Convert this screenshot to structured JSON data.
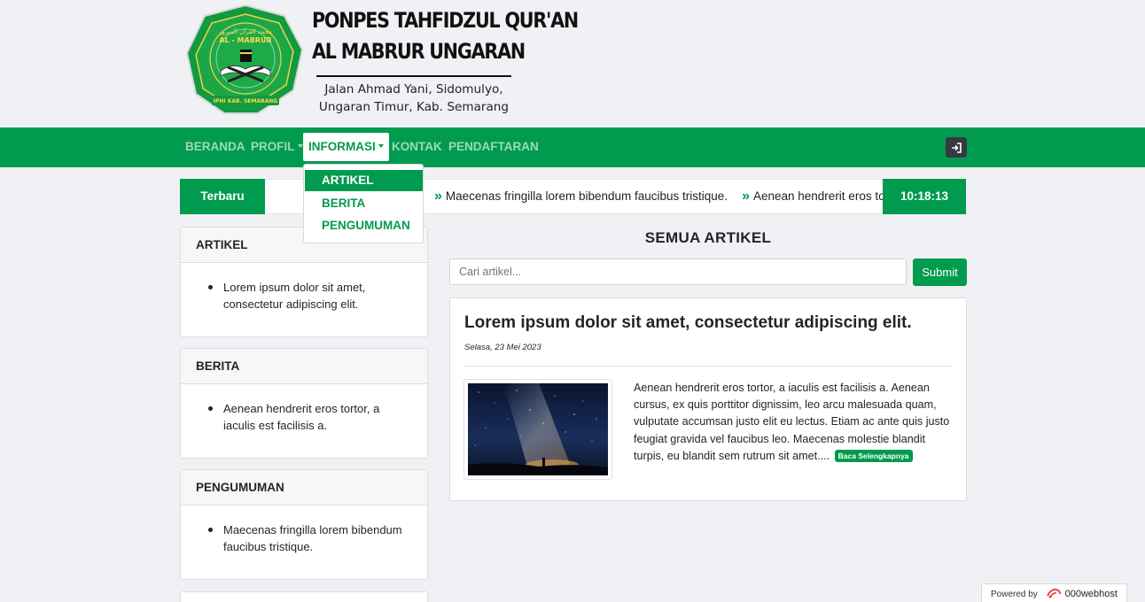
{
  "brand": {
    "title_line1": "PONPES TAHFIDZUL QUR'AN",
    "title_line2": "AL MABRUR UNGARAN",
    "address": "Jalan Ahmad Yani, Sidomulyo,\nUngaran Timur, Kab. Semarang",
    "logo_text": "AL - MABRUR",
    "logo_arabic": "محمد القرآن المبرور",
    "logo_bottom": "IPHI KAB. SEMARANG",
    "logo_subtitle": "PONDOK PESANTREN TAHFIDZUL QUR'AN"
  },
  "nav": {
    "items": [
      {
        "label": "BERANDA"
      },
      {
        "label": "PROFIL"
      },
      {
        "label": "INFORMASI"
      },
      {
        "label": "KONTAK"
      },
      {
        "label": "PENDAFTARAN"
      }
    ],
    "active": "INFORMASI",
    "login_icon": "sign-in-icon"
  },
  "dropdown": {
    "items": [
      {
        "label": "ARTIKEL"
      },
      {
        "label": "BERITA"
      },
      {
        "label": "PENGUMUMAN"
      }
    ],
    "active": "ARTIKEL"
  },
  "ticker": {
    "label": "Terbaru",
    "items": [
      "Maecenas fringilla lorem bibendum faucibus tristique.",
      "Aenean hendrerit eros tortor, a iaculis est facilisis a."
    ],
    "clock": "10:18:13"
  },
  "sidebar": {
    "sections": [
      {
        "title": "ARTIKEL",
        "items": [
          "Lorem ipsum dolor sit amet, consectetur adipiscing elit."
        ]
      },
      {
        "title": "BERITA",
        "items": [
          "Aenean hendrerit eros tortor, a iaculis est facilisis a."
        ]
      },
      {
        "title": "PENGUMUMAN",
        "items": [
          "Maecenas fringilla lorem bibendum faucibus tristique."
        ]
      }
    ]
  },
  "main": {
    "heading": "SEMUA ARTIKEL",
    "search_placeholder": "Cari artikel...",
    "submit_label": "Submit",
    "article": {
      "title": "Lorem ipsum dolor sit amet, consectetur adipiscing elit.",
      "date": "Selasa, 23 Mei 2023",
      "excerpt": "Aenean hendrerit eros tortor, a iaculis est facilisis a. Aenean cursus, ex quis porttitor dignissim, leo arcu malesuada quam, vulputate accumsan justo elit eu lectus. Etiam ac ante quis justo feugiat gravida vel faucibus leo. Maecenas molestie blandit turpis, eu blandit sem rutrum sit amet....",
      "read_more": "Baca Selengkapnya"
    }
  },
  "footer": {
    "powered_by": "Powered by",
    "host": "000webhost"
  },
  "colors": {
    "brand_green": "#009b4e",
    "nav_inactive": "#9fd9b7",
    "page_bg": "#f0f1f5"
  }
}
